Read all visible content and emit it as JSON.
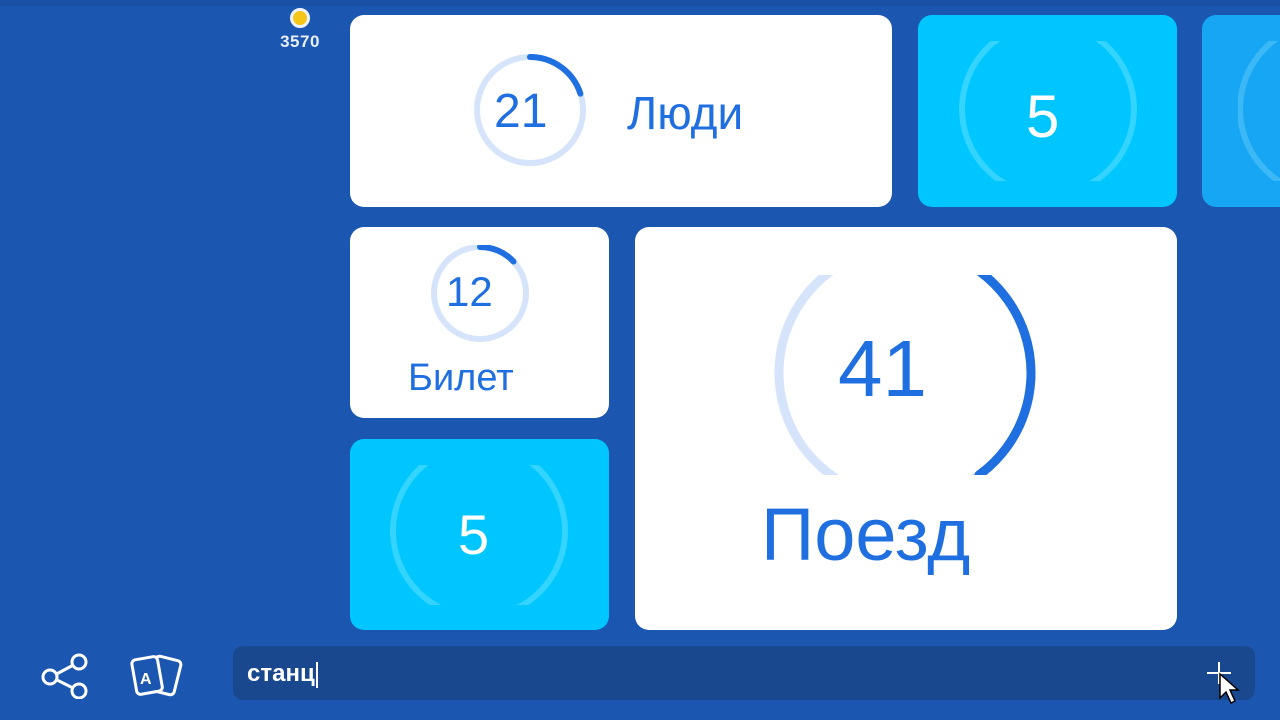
{
  "currency": {
    "icon": "coin-icon",
    "amount": "3570"
  },
  "tiles": [
    {
      "id": "people",
      "value": "21",
      "word": "Люди",
      "progress": 0.2,
      "style": "white"
    },
    {
      "id": "hidden-5-top",
      "value": "5",
      "progress": 0.07,
      "style": "cyan"
    },
    {
      "id": "ticket",
      "value": "12",
      "word": "Билет",
      "progress": 0.13,
      "style": "white"
    },
    {
      "id": "train",
      "value": "41",
      "word": "Поезд",
      "progress": 0.4,
      "style": "white"
    },
    {
      "id": "hidden-5-bottom",
      "value": "5",
      "progress": 0.07,
      "style": "cyan"
    }
  ],
  "input": {
    "value": "станц"
  },
  "toolbar": {
    "share_icon": "share-icon",
    "cards_icon": "cards-icon",
    "add_icon": "plus-icon"
  },
  "colors": {
    "background": "#1b56b0",
    "accent": "#1f6fe0",
    "cyan": "#00c6ff",
    "tile": "#ffffff"
  }
}
